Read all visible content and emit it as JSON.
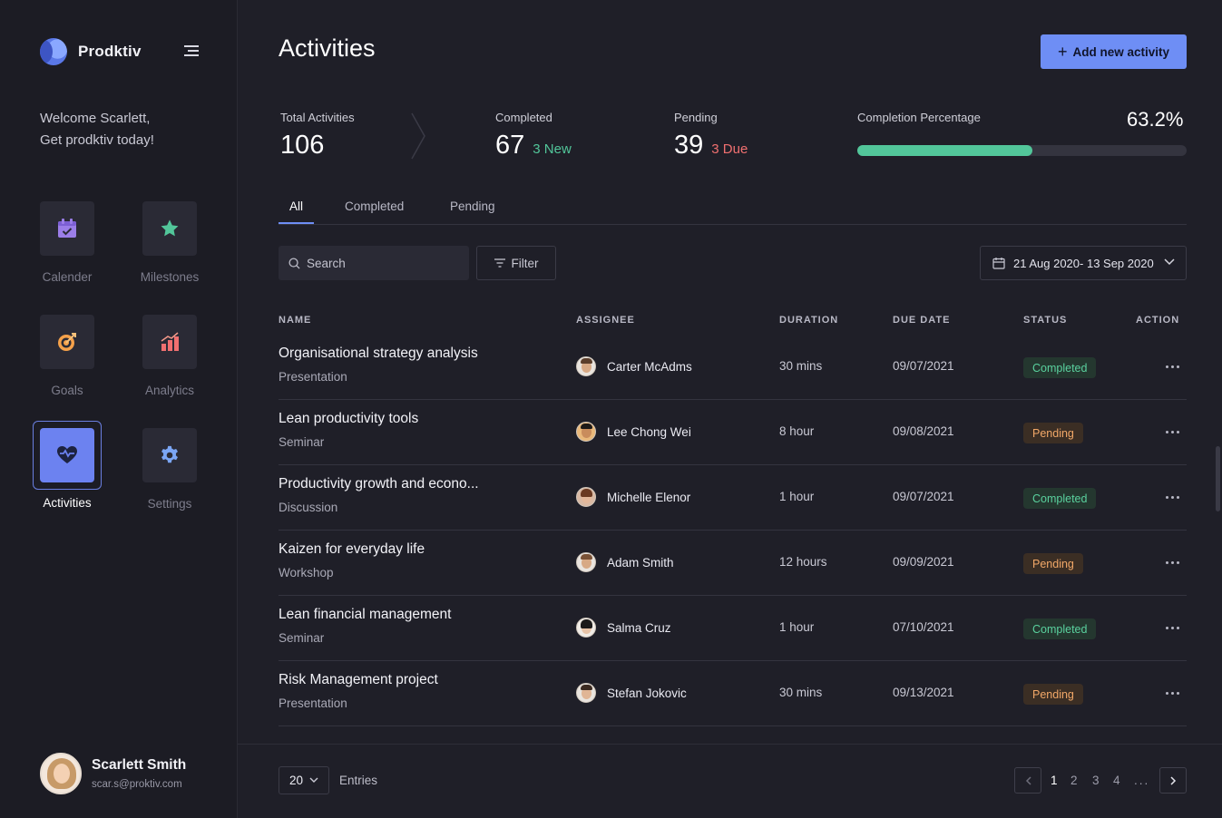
{
  "app": {
    "name": "Prodktiv"
  },
  "sidebar": {
    "welcome_line1": "Welcome Scarlett,",
    "welcome_line2": "Get prodktiv today!",
    "items": [
      {
        "label": "Calender",
        "icon": "calendar-icon",
        "color": "#9b7ee8"
      },
      {
        "label": "Milestones",
        "icon": "star-icon",
        "color": "#52c69a"
      },
      {
        "label": "Goals",
        "icon": "target-icon",
        "color": "#f5a14a"
      },
      {
        "label": "Analytics",
        "icon": "bar-chart-icon",
        "color": "#f07070"
      },
      {
        "label": "Activities",
        "icon": "heart-pulse-icon",
        "color": "#6c82f0",
        "active": true
      },
      {
        "label": "Settings",
        "icon": "gear-icon",
        "color": "#7ba6f5"
      }
    ],
    "user": {
      "name": "Scarlett Smith",
      "email": "scar.s@proktiv.com"
    }
  },
  "header": {
    "title": "Activities",
    "add_button_label": "Add new activity",
    "accent": "#6e8ef5"
  },
  "stats": {
    "total": {
      "label": "Total Activities",
      "value": "106"
    },
    "completed": {
      "label": "Completed",
      "value": "67",
      "sub": "3 New",
      "sub_color": "#52c69a"
    },
    "pending": {
      "label": "Pending",
      "value": "39",
      "sub": "3 Due",
      "sub_color": "#f07070"
    },
    "completion": {
      "label": "Completion Percentage",
      "value": "63.2%",
      "fraction": 0.532
    }
  },
  "tabs": [
    {
      "label": "All",
      "active": true
    },
    {
      "label": "Completed"
    },
    {
      "label": "Pending"
    }
  ],
  "toolbar": {
    "search_placeholder": "Search",
    "filter_label": "Filter",
    "date_range": "21 Aug 2020-  13 Sep 2020"
  },
  "table": {
    "headers": [
      "NAME",
      "ASSIGNEE",
      "DURATION",
      "DUE DATE",
      "STATUS",
      "ACTION"
    ],
    "rows": [
      {
        "name": "Organisational strategy analysis",
        "type": "Presentation",
        "assignee": "Carter McAdms",
        "duration": "30 mins",
        "due": "09/07/2021",
        "status": "Completed"
      },
      {
        "name": "Lean productivity tools",
        "type": "Seminar",
        "assignee": "Lee Chong Wei",
        "duration": "8 hour",
        "due": "09/08/2021",
        "status": "Pending"
      },
      {
        "name": "Productivity growth and  econo...",
        "type": "Discussion",
        "assignee": "Michelle Elenor",
        "duration": "1 hour",
        "due": "09/07/2021",
        "status": "Completed"
      },
      {
        "name": "Kaizen for everyday life",
        "type": "Workshop",
        "assignee": "Adam Smith",
        "duration": "12 hours",
        "due": "09/09/2021",
        "status": "Pending"
      },
      {
        "name": "Lean financial management",
        "type": "Seminar",
        "assignee": "Salma Cruz",
        "duration": "1 hour",
        "due": "07/10/2021",
        "status": "Completed"
      },
      {
        "name": "Risk Management project",
        "type": "Presentation",
        "assignee": "Stefan Jokovic",
        "duration": "30 mins",
        "due": "09/13/2021",
        "status": "Pending"
      }
    ]
  },
  "footer": {
    "per_page": "20",
    "entries_label": "Entries",
    "pages": [
      "1",
      "2",
      "3",
      "4",
      "..."
    ],
    "current_page": "1"
  }
}
